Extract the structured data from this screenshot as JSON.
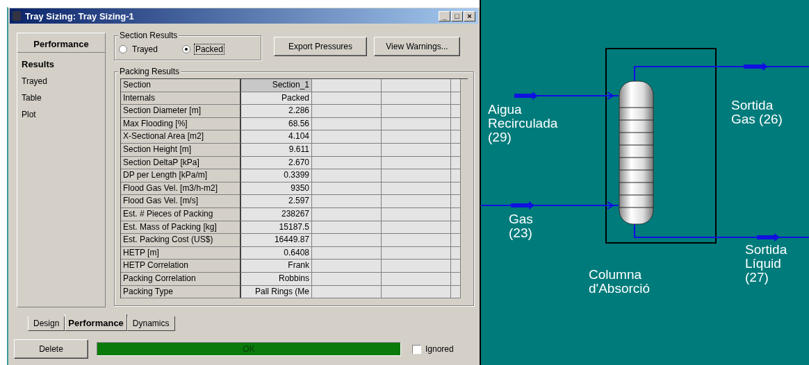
{
  "window": {
    "title": "Tray Sizing: Tray Sizing-1",
    "controls": [
      "_",
      "□",
      "×"
    ]
  },
  "sidebar": {
    "header": "Performance",
    "items": [
      {
        "label": "Results",
        "selected": true
      },
      {
        "label": "Trayed",
        "selected": false
      },
      {
        "label": "Table",
        "selected": false
      },
      {
        "label": "Plot",
        "selected": false
      }
    ]
  },
  "section_results": {
    "title": "Section Results",
    "options": [
      {
        "label": "Trayed",
        "selected": false
      },
      {
        "label": "Packed",
        "selected": true
      }
    ]
  },
  "buttons": [
    "Export Pressures",
    "View Warnings..."
  ],
  "packing_results": {
    "title": "Packing Results",
    "rows": [
      [
        "Section",
        "Section_1"
      ],
      [
        "Internals",
        "Packed"
      ],
      [
        "Section Diameter [m]",
        "2.286"
      ],
      [
        "Max Flooding [%]",
        "68.56"
      ],
      [
        "X-Sectional Area [m2]",
        "4.104"
      ],
      [
        "Section Height [m]",
        "9.611"
      ],
      [
        "Section DeltaP [kPa]",
        "2.670"
      ],
      [
        "DP per Length [kPa/m]",
        "0.3399"
      ],
      [
        "Flood Gas Vel. [m3/h-m2]",
        "9350"
      ],
      [
        "Flood Gas Vel. [m/s]",
        "2.597"
      ],
      [
        "Est. # Pieces of Packing",
        "238267"
      ],
      [
        "Est. Mass of Packing [kg]",
        "15187.5"
      ],
      [
        "Est. Packing Cost (US$)",
        "16449.87"
      ],
      [
        "HETP [m]",
        "0.6408"
      ],
      [
        "HETP Correlation",
        "Frank"
      ],
      [
        "Packing Correlation",
        "Robbins"
      ],
      [
        "Packing Type",
        "Pall Rings (Me"
      ]
    ]
  },
  "tabs": [
    {
      "label": "Design",
      "selected": false
    },
    {
      "label": "Performance",
      "selected": true
    },
    {
      "label": "Dynamics",
      "selected": false
    }
  ],
  "footer": {
    "delete": "Delete",
    "status": {
      "text": "OK",
      "color": "#0a7a0a",
      "level": 1
    },
    "ignored": {
      "label": "Ignored",
      "checked": false
    }
  },
  "diagram": {
    "unit": "Columna d'Absorció",
    "streams": [
      {
        "label": "Aigua Recirculada (29)",
        "kind": "inlet-top"
      },
      {
        "label": "Gas (23)",
        "kind": "inlet-bottom"
      },
      {
        "label": "Sortida Gas (26)",
        "kind": "outlet-top"
      },
      {
        "label": "Sortida Líquid (27)",
        "kind": "outlet-bottom"
      }
    ]
  }
}
